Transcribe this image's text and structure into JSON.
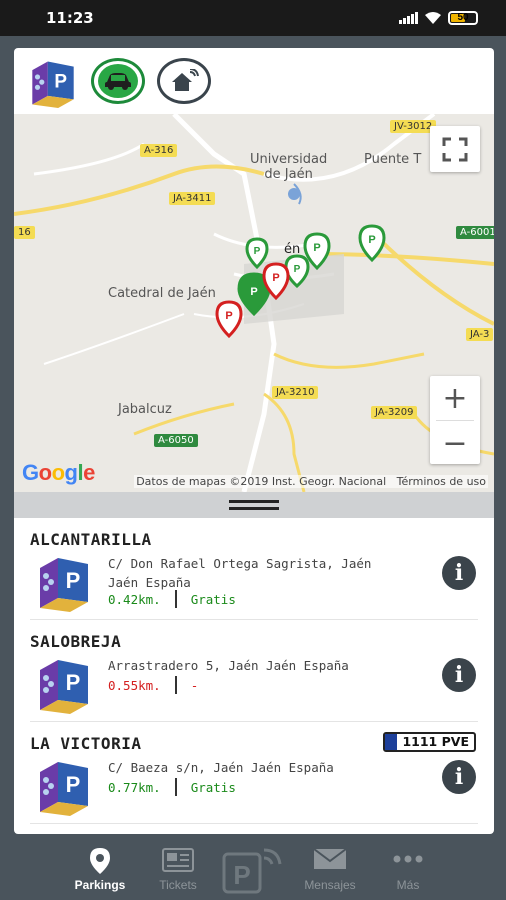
{
  "status_bar": {
    "time": "11:23",
    "battery": "50"
  },
  "map": {
    "places": [
      {
        "name": "Universidad\nde Jaén"
      },
      {
        "name": "Puente T"
      },
      {
        "name": "Catedral de Jaén"
      },
      {
        "name": "Jabalcuz"
      },
      {
        "name": "én"
      }
    ],
    "roads": [
      "A-316",
      "JA-3411",
      "JV-3012",
      "A-6001",
      "JA-3210",
      "JA-3209",
      "A-6050",
      "16",
      "JA-3"
    ],
    "zoom_in": "+",
    "zoom_out": "−",
    "google_logo": "Google",
    "attribution": "Datos de mapas ©2019 Inst. Geogr. Nacional",
    "terms": "Términos de uso"
  },
  "parkings": [
    {
      "name": "ALCANTARILLA",
      "address": "C/ Don Rafael Ortega Sagrista, Jaén Jaén España",
      "distance": "0.42km.",
      "price": "Gratis",
      "distance_color": "#1a8a1a",
      "price_color": "#1a8a1a",
      "plate": ""
    },
    {
      "name": "SALOBREJA",
      "address": "Arrastradero 5, Jaén Jaén España",
      "distance": "0.55km.",
      "price": "-",
      "distance_color": "#d42020",
      "price_color": "#d42020",
      "plate": ""
    },
    {
      "name": "LA VICTORIA",
      "address": "C/ Baeza s/n, Jaén Jaén España",
      "distance": "0.77km.",
      "price": "Gratis",
      "distance_color": "#1a8a1a",
      "price_color": "#1a8a1a",
      "plate": "1111 PVE"
    }
  ],
  "nav": {
    "parkings": "Parkings",
    "tickets": "Tickets",
    "mensajes": "Mensajes",
    "mas": "Más"
  },
  "colors": {
    "accent_green": "#29a745",
    "dark": "#3b444b",
    "red": "#d42020"
  }
}
